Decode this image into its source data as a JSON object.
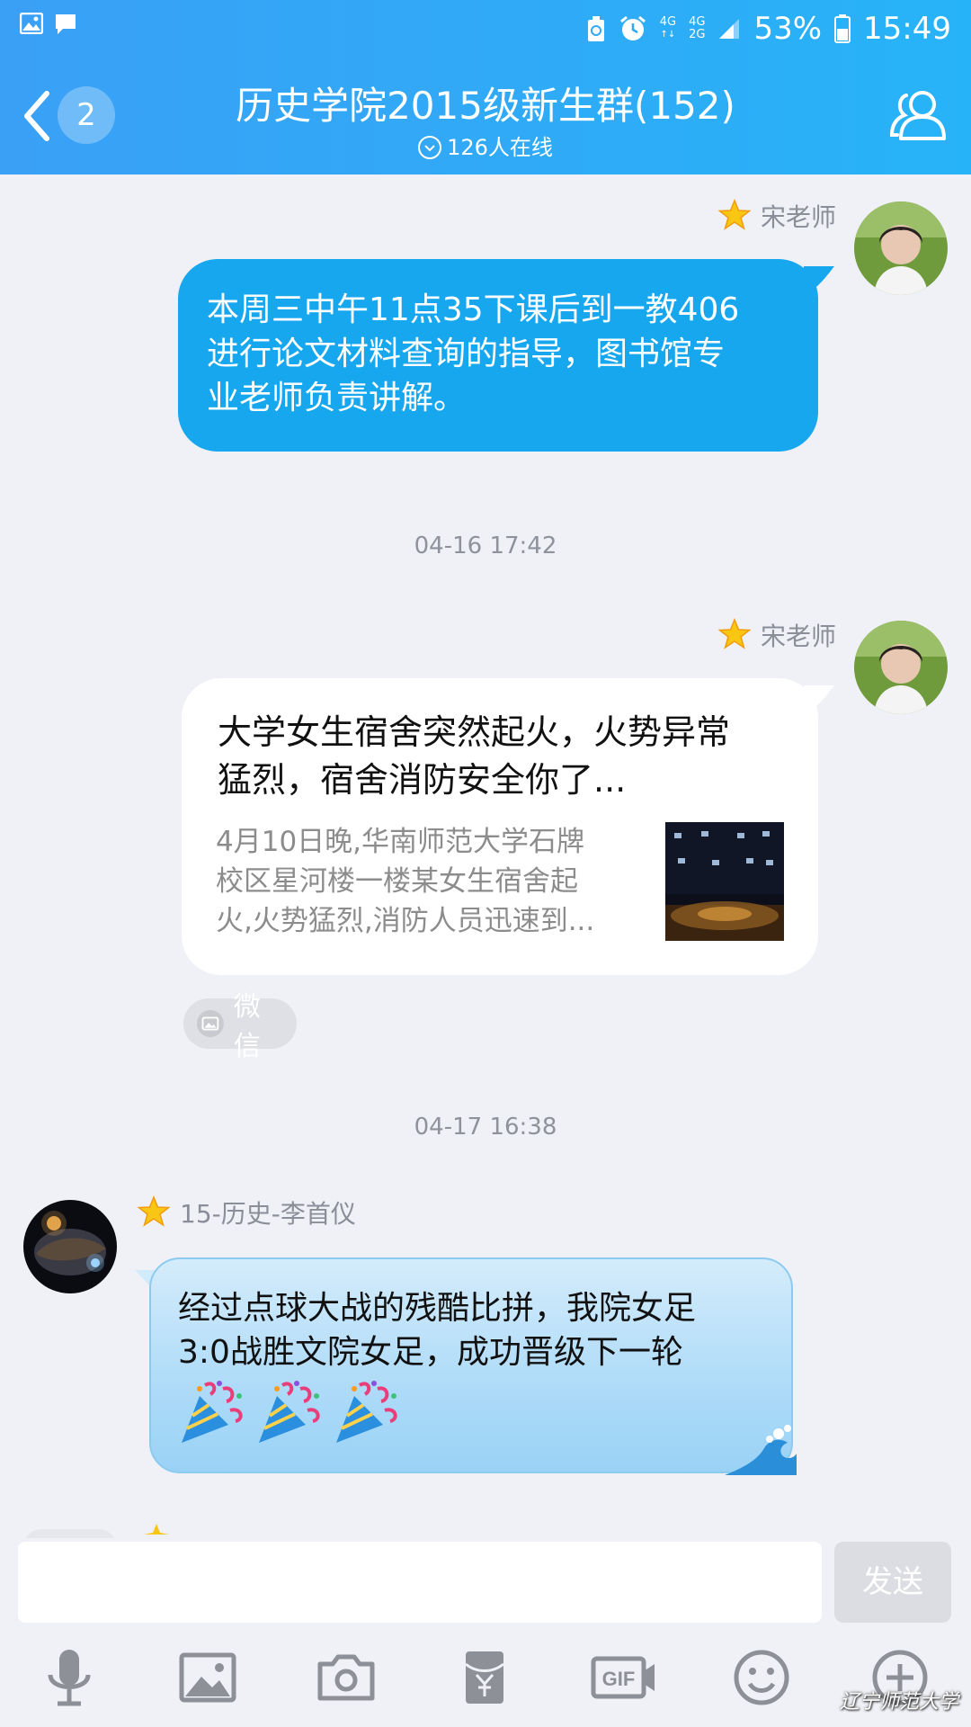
{
  "status_bar": {
    "network_top": "4G",
    "network_bottom_a": "4G",
    "network_bottom_b": "2G",
    "battery": "53%",
    "time": "15:49"
  },
  "header": {
    "unread_count": "2",
    "title": "历史学院2015级新生群(152)",
    "online": "126人在线"
  },
  "messages": [
    {
      "sender": "宋老师",
      "text_lines": [
        "本周三中午11点35下课后到一教406",
        "进行论文材料查询的指导，图书馆专",
        "业老师负责讲解。"
      ]
    },
    {
      "timestamp": "04-16 17:42"
    },
    {
      "sender": "宋老师",
      "card_title_lines": [
        "大学女生宿舍突然起火，火势异常",
        "猛烈，宿舍消防安全你了..."
      ],
      "card_desc_lines": [
        "4月10日晚,华南师范大学石牌",
        "校区星河楼一楼某女生宿舍起",
        "火,火势猛烈,消防人员迅速到..."
      ],
      "source": "微信"
    },
    {
      "timestamp": "04-17 16:38"
    },
    {
      "sender": "15-历史-李首仪",
      "text_lines": [
        "经过点球大战的残酷比拼，我院女足",
        "3:0战胜文院女足，成功晋级下一轮"
      ],
      "emojis": [
        "party-popper-icon",
        "party-popper-icon",
        "party-popper-icon"
      ]
    }
  ],
  "input": {
    "send_label": "发送"
  },
  "watermark": "辽宁师范大学",
  "colors": {
    "header": "#2fa9f6",
    "bubble_blue": "#16a7ef",
    "background": "#f0f1f6"
  }
}
